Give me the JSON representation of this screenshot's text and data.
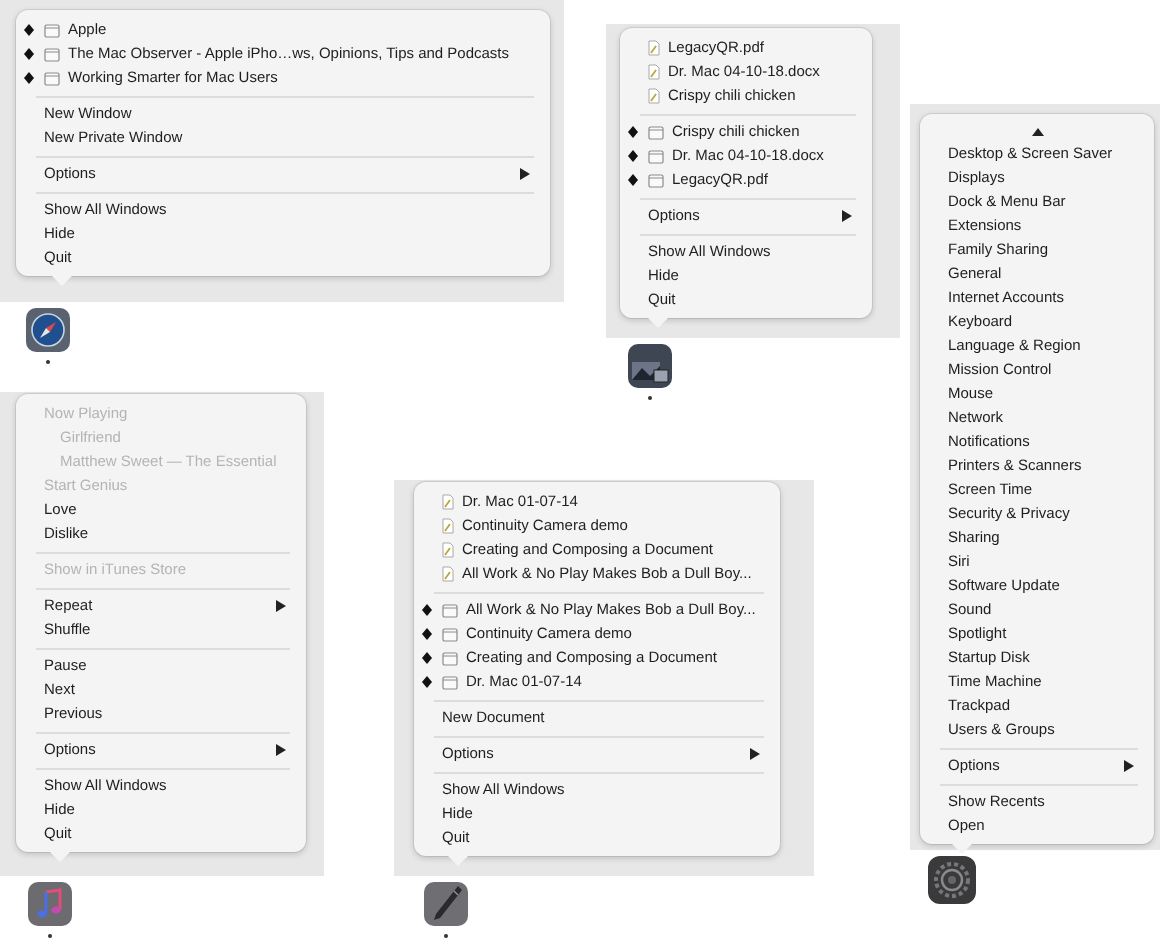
{
  "dock_menus": [
    {
      "kind": "compass",
      "running": true,
      "scroll_up": false,
      "sections": [
        [
          {
            "kind": "window",
            "label": "Apple"
          },
          {
            "kind": "window",
            "label": "The Mac Observer - Apple iPho…ws, Opinions, Tips and Podcasts"
          },
          {
            "kind": "window",
            "label": "Working Smarter for Mac Users"
          }
        ],
        [
          {
            "kind": "plain",
            "label": "New Window"
          },
          {
            "kind": "plain",
            "label": "New Private Window"
          }
        ],
        [
          {
            "kind": "submenu",
            "label": "Options"
          }
        ],
        [
          {
            "kind": "plain",
            "label": "Show All Windows"
          },
          {
            "kind": "plain",
            "label": "Hide"
          },
          {
            "kind": "plain",
            "label": "Quit"
          }
        ]
      ]
    },
    {
      "kind": "photos",
      "running": true,
      "scroll_up": false,
      "sections": [
        [
          {
            "kind": "document",
            "label": "LegacyQR.pdf"
          },
          {
            "kind": "document",
            "label": "Dr. Mac 04-10-18.docx"
          },
          {
            "kind": "document",
            "label": "Crispy chili chicken"
          }
        ],
        [
          {
            "kind": "window",
            "label": "Crispy chili chicken"
          },
          {
            "kind": "window",
            "label": "Dr. Mac 04-10-18.docx"
          },
          {
            "kind": "window",
            "label": "LegacyQR.pdf"
          }
        ],
        [
          {
            "kind": "submenu",
            "label": "Options"
          }
        ],
        [
          {
            "kind": "plain",
            "label": "Show All Windows"
          },
          {
            "kind": "plain",
            "label": "Hide"
          },
          {
            "kind": "plain",
            "label": "Quit"
          }
        ]
      ]
    },
    {
      "kind": "gear",
      "running": false,
      "scroll_up": true,
      "sections": [
        [
          {
            "kind": "plain",
            "label": "Desktop & Screen Saver"
          },
          {
            "kind": "plain",
            "label": "Displays"
          },
          {
            "kind": "plain",
            "label": "Dock & Menu Bar"
          },
          {
            "kind": "plain",
            "label": "Extensions"
          },
          {
            "kind": "plain",
            "label": "Family Sharing"
          },
          {
            "kind": "plain",
            "label": "General"
          },
          {
            "kind": "plain",
            "label": "Internet Accounts"
          },
          {
            "kind": "plain",
            "label": "Keyboard"
          },
          {
            "kind": "plain",
            "label": "Language & Region"
          },
          {
            "kind": "plain",
            "label": "Mission Control"
          },
          {
            "kind": "plain",
            "label": "Mouse"
          },
          {
            "kind": "plain",
            "label": "Network"
          },
          {
            "kind": "plain",
            "label": "Notifications"
          },
          {
            "kind": "plain",
            "label": "Printers & Scanners"
          },
          {
            "kind": "plain",
            "label": "Screen Time"
          },
          {
            "kind": "plain",
            "label": "Security & Privacy"
          },
          {
            "kind": "plain",
            "label": "Sharing"
          },
          {
            "kind": "plain",
            "label": "Siri"
          },
          {
            "kind": "plain",
            "label": "Software Update"
          },
          {
            "kind": "plain",
            "label": "Sound"
          },
          {
            "kind": "plain",
            "label": "Spotlight"
          },
          {
            "kind": "plain",
            "label": "Startup Disk"
          },
          {
            "kind": "plain",
            "label": "Time Machine"
          },
          {
            "kind": "plain",
            "label": "Trackpad"
          },
          {
            "kind": "plain",
            "label": "Users & Groups"
          }
        ],
        [
          {
            "kind": "submenu",
            "label": "Options"
          }
        ],
        [
          {
            "kind": "plain",
            "label": "Show Recents"
          },
          {
            "kind": "plain",
            "label": "Open"
          }
        ]
      ]
    },
    {
      "kind": "music",
      "running": true,
      "scroll_up": false,
      "sections": [
        [
          {
            "kind": "plain",
            "label": "Now Playing",
            "disabled": true,
            "children": [
              {
                "kind": "plain",
                "label": "Girlfriend",
                "disabled": true
              },
              {
                "kind": "plain",
                "label": "Matthew Sweet — The Essential",
                "disabled": true
              }
            ]
          },
          {
            "kind": "plain",
            "label": "Start Genius",
            "disabled": true
          },
          {
            "kind": "plain",
            "label": "Love",
            "disabled": false
          },
          {
            "kind": "plain",
            "label": "Dislike",
            "disabled": false
          }
        ],
        [
          {
            "kind": "plain",
            "label": "Show in iTunes Store",
            "disabled": true
          }
        ],
        [
          {
            "kind": "submenu",
            "label": "Repeat",
            "disabled": false
          },
          {
            "kind": "plain",
            "label": "Shuffle",
            "disabled": false
          }
        ],
        [
          {
            "kind": "plain",
            "label": "Pause",
            "disabled": false
          },
          {
            "kind": "plain",
            "label": "Next",
            "disabled": false
          },
          {
            "kind": "plain",
            "label": "Previous",
            "disabled": false
          }
        ],
        [
          {
            "kind": "submenu",
            "label": "Options",
            "disabled": false
          }
        ],
        [
          {
            "kind": "plain",
            "label": "Show All Windows",
            "disabled": false
          },
          {
            "kind": "plain",
            "label": "Hide",
            "disabled": false
          },
          {
            "kind": "plain",
            "label": "Quit",
            "disabled": false
          }
        ]
      ]
    },
    {
      "kind": "pen",
      "running": true,
      "scroll_up": false,
      "sections": [
        [
          {
            "kind": "document",
            "label": "Dr. Mac 01-07-14"
          },
          {
            "kind": "document",
            "label": "Continuity Camera demo"
          },
          {
            "kind": "document",
            "label": "Creating and Composing a Document"
          },
          {
            "kind": "document",
            "label": "All Work & No Play Makes Bob a Dull Boy..."
          }
        ],
        [
          {
            "kind": "window",
            "label": "All Work & No Play Makes Bob a Dull Boy..."
          },
          {
            "kind": "window",
            "label": "Continuity Camera demo"
          },
          {
            "kind": "window",
            "label": "Creating and Composing a Document"
          },
          {
            "kind": "window",
            "label": "Dr. Mac 01-07-14"
          }
        ],
        [
          {
            "kind": "plain",
            "label": "New Document"
          }
        ],
        [
          {
            "kind": "submenu",
            "label": "Options"
          }
        ],
        [
          {
            "kind": "plain",
            "label": "Show All Windows"
          },
          {
            "kind": "plain",
            "label": "Hide"
          },
          {
            "kind": "plain",
            "label": "Quit"
          }
        ]
      ]
    }
  ]
}
